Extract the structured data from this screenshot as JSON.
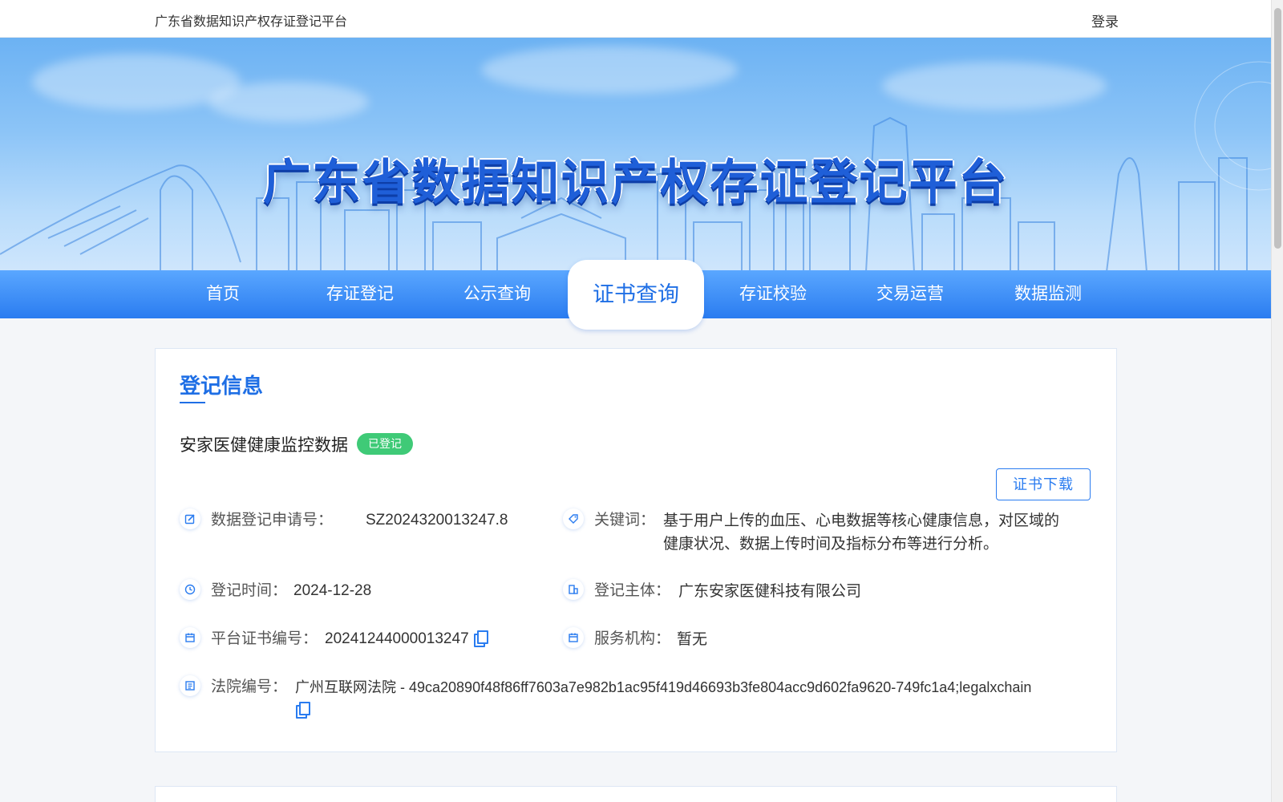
{
  "topbar": {
    "site_name": "广东省数据知识产权存证登记平台",
    "login": "登录"
  },
  "banner": {
    "title": "广东省数据知识产权存证登记平台"
  },
  "nav": {
    "items": [
      {
        "label": "首页"
      },
      {
        "label": "存证登记"
      },
      {
        "label": "公示查询"
      },
      {
        "label": "证书查询"
      },
      {
        "label": "存证校验"
      },
      {
        "label": "交易运营"
      },
      {
        "label": "数据监测"
      }
    ],
    "active_label": "证书查询"
  },
  "panel": {
    "section_title": "登记信息",
    "record_name": "安家医健健康监控数据",
    "status": "已登记",
    "download_label": "证书下载",
    "fields": {
      "apply_no": {
        "label": "数据登记申请号：",
        "value": "SZ2024320013247.8",
        "icon": "edit-icon"
      },
      "keywords": {
        "label": "关键词：",
        "value_line1": "基于用户上传的血压、心电数据等核心健康信息，对区域的",
        "value_line2": "健康状况、数据上传时间及指标分布等进行分析。",
        "icon": "tag-icon"
      },
      "reg_time": {
        "label": "登记时间：",
        "value": "2024-12-28",
        "icon": "clock-icon"
      },
      "reg_subject": {
        "label": "登记主体：",
        "value": "广东安家医健科技有限公司",
        "icon": "organization-icon"
      },
      "cert_no": {
        "label": "平台证书编号：",
        "value": "20241244000013247",
        "icon": "calendar-icon"
      },
      "service_org": {
        "label": "服务机构：",
        "value": "暂无",
        "icon": "calendar-icon"
      },
      "court_no": {
        "label": "法院编号：",
        "value_prefix": "广州互联网法院",
        "value": " - 49ca20890f48f86ff7603a7e982b1ac95f419d46693b3fe804acc9d602fa9620-749fc1a4;legalxchain",
        "icon": "document-list-icon"
      }
    }
  },
  "colors": {
    "primary": "#1f6fe5",
    "status_green": "#3fca77",
    "nav_blue": "#2a7cf0"
  }
}
